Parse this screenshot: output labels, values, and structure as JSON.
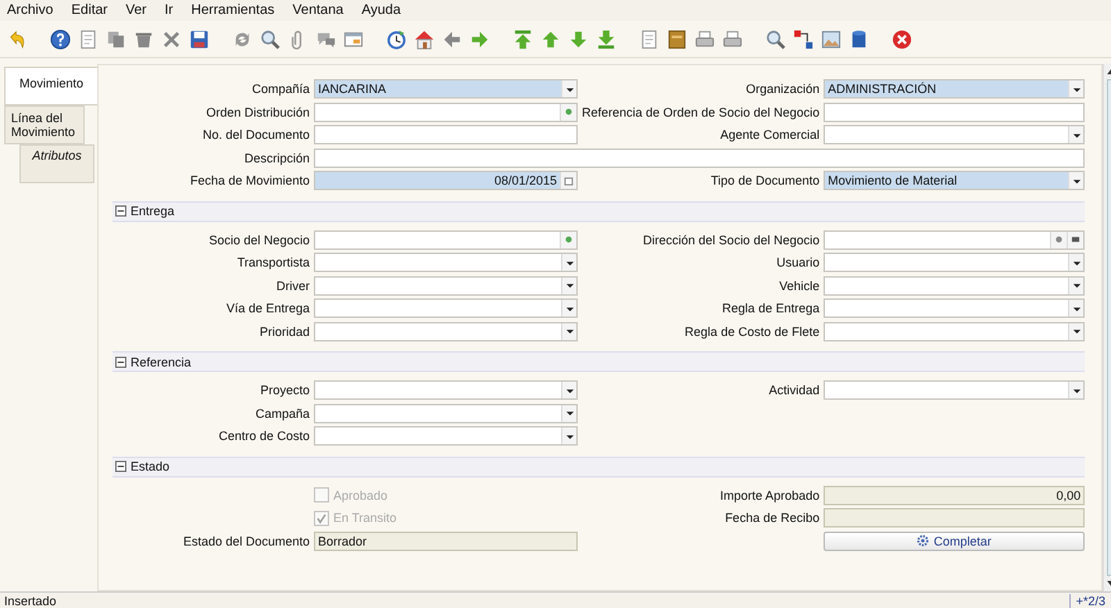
{
  "menu": [
    "Archivo",
    "Editar",
    "Ver",
    "Ir",
    "Herramientas",
    "Ventana",
    "Ayuda"
  ],
  "tabs": [
    {
      "label": "Movimiento",
      "selected": true
    },
    {
      "label": "Línea del Movimiento",
      "selected": false,
      "children": [
        {
          "label": "Atributos",
          "selected": false
        }
      ]
    }
  ],
  "sections": [
    {
      "rows": [
        {
          "left": {
            "label": "Compañía",
            "kind": "select",
            "value": "IANCARINA",
            "mandatory": true,
            "readonly": false
          },
          "right": {
            "label": "Organización",
            "kind": "select",
            "value": "ADMINISTRACIÓN",
            "mandatory": true,
            "readonly": false
          }
        },
        {
          "left": {
            "label": "Orden Distribución",
            "kind": "lookup",
            "mandatory": false,
            "readonly": false
          },
          "right": {
            "label": "Referencia de Orden de Socio del Negocio",
            "kind": "text",
            "mandatory": false,
            "readonly": false
          }
        },
        {
          "left": {
            "label": "No. del Documento",
            "kind": "text",
            "mandatory": false,
            "readonly": false
          },
          "right": {
            "label": "Agente Comercial",
            "kind": "select",
            "mandatory": false,
            "readonly": false
          }
        },
        {
          "wide": {
            "label": "Descripción",
            "kind": "text",
            "mandatory": false,
            "readonly": false
          }
        },
        {
          "left": {
            "label": "Fecha de Movimiento",
            "kind": "date",
            "value": "08/01/2015",
            "mandatory": true,
            "readonly": false
          },
          "right": {
            "label": "Tipo de Documento",
            "kind": "select",
            "value": "Movimiento de Material",
            "mandatory": true,
            "readonly": false
          }
        }
      ]
    },
    {
      "title": "Entrega",
      "expanded": true,
      "rows": [
        {
          "left": {
            "label": "Socio del Negocio",
            "kind": "lookup",
            "mandatory": false,
            "readonly": false
          },
          "right": {
            "label": "Dirección del Socio del Negocio",
            "kind": "address",
            "mandatory": false,
            "readonly": false
          }
        },
        {
          "left": {
            "label": "Transportista",
            "kind": "select",
            "mandatory": false,
            "readonly": false
          },
          "right": {
            "label": "Usuario",
            "kind": "select",
            "mandatory": false,
            "readonly": false
          }
        },
        {
          "left": {
            "label": "Driver",
            "kind": "select",
            "mandatory": false,
            "readonly": false
          },
          "right": {
            "label": "Vehicle",
            "kind": "select",
            "mandatory": false,
            "readonly": false
          }
        },
        {
          "left": {
            "label": "Vía de Entrega",
            "kind": "select",
            "mandatory": false,
            "readonly": false
          },
          "right": {
            "label": "Regla de Entrega",
            "kind": "select",
            "mandatory": false,
            "readonly": false
          }
        },
        {
          "left": {
            "label": "Prioridad",
            "kind": "select",
            "mandatory": false,
            "readonly": false
          },
          "right": {
            "label": "Regla de Costo de Flete",
            "kind": "select",
            "mandatory": false,
            "readonly": false
          }
        }
      ]
    },
    {
      "title": "Referencia",
      "expanded": true,
      "rows": [
        {
          "left": {
            "label": "Proyecto",
            "kind": "select",
            "mandatory": false,
            "readonly": false
          },
          "right": {
            "label": "Actividad",
            "kind": "select",
            "mandatory": false,
            "readonly": false
          }
        },
        {
          "left": {
            "label": "Campaña",
            "kind": "select",
            "mandatory": false,
            "readonly": false
          }
        },
        {
          "left": {
            "label": "Centro de Costo",
            "kind": "select",
            "mandatory": false,
            "readonly": false
          }
        }
      ]
    },
    {
      "title": "Estado",
      "expanded": true,
      "rows": [
        {
          "left": {
            "label": "Aprobado",
            "kind": "checkbox",
            "checked": false,
            "disabled": true
          },
          "right": {
            "label": "Importe Aprobado",
            "kind": "number",
            "value": "0,00",
            "mandatory": false,
            "readonly": true
          }
        },
        {
          "left": {
            "label": "En Transito",
            "kind": "checkbox",
            "checked": true,
            "disabled": true
          },
          "right": {
            "label": "Fecha de Recibo",
            "kind": "text",
            "mandatory": false,
            "readonly": true
          }
        },
        {
          "left": {
            "label": "Estado del Documento",
            "kind": "text",
            "value": "Borrador",
            "mandatory": false,
            "readonly": true
          },
          "right": {
            "kind": "button",
            "label": "Completar"
          }
        }
      ]
    }
  ],
  "status_bar": {
    "message": "Insertado",
    "record": "+*2/3"
  }
}
